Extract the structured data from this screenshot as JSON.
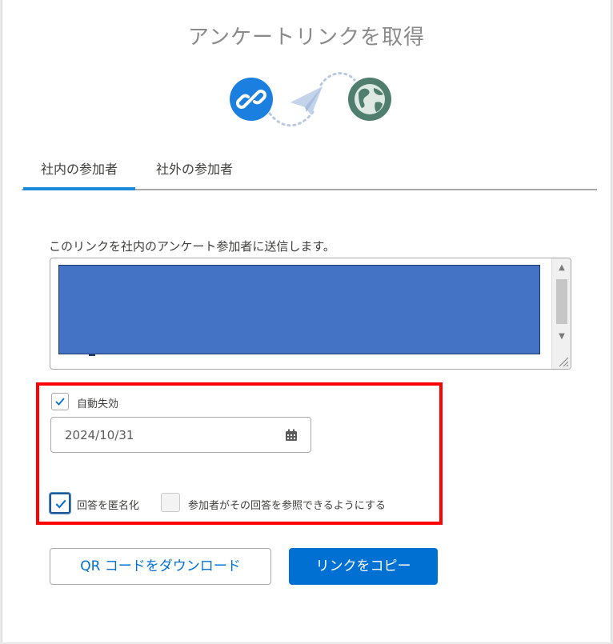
{
  "dialog": {
    "title": "アンケートリンクを取得"
  },
  "tabs": [
    {
      "label": "社内の参加者",
      "active": true
    },
    {
      "label": "社外の参加者",
      "active": false
    }
  ],
  "link_section": {
    "description": "このリンクを社内のアンケート参加者に送信します。",
    "link_value": ""
  },
  "auto_expire": {
    "label": "自動失効",
    "checked": true,
    "date_value": "2024/10/31"
  },
  "anonymize": {
    "label": "回答を匿名化",
    "checked": true
  },
  "participants_view": {
    "label": "参加者がその回答を参照できるようにする",
    "checked": false
  },
  "buttons": {
    "download_qr": "QR コードをダウンロード",
    "copy_link": "リンクをコピー"
  },
  "colors": {
    "brand_blue": "#0070d2",
    "tab_active": "#1b8ad9",
    "highlight_red": "#ff0000",
    "globe_green": "#4f7d6e",
    "redaction_blue": "#4472c4"
  },
  "icons": {
    "link": "link-icon",
    "plane": "paper-plane-icon",
    "globe": "globe-icon",
    "calendar": "calendar-icon",
    "check": "check-icon"
  }
}
